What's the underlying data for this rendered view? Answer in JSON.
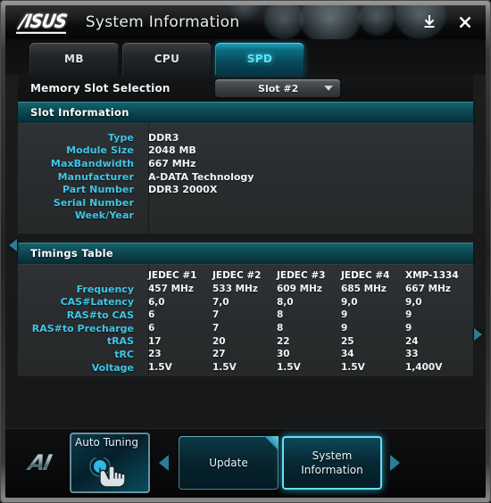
{
  "window": {
    "brand": "/ISUS",
    "title": "System Information",
    "buttons": [
      {
        "name": "save-icon",
        "label": "download"
      },
      {
        "name": "close-icon",
        "label": "close"
      }
    ]
  },
  "tabs": [
    {
      "id": "mb",
      "label": "MB",
      "active": false
    },
    {
      "id": "cpu",
      "label": "CPU",
      "active": false
    },
    {
      "id": "spd",
      "label": "SPD",
      "active": true
    }
  ],
  "slot_selection": {
    "label": "Memory Slot Selection",
    "value": "Slot #2",
    "caret": "chevron-down-icon"
  },
  "slot_information": {
    "heading": "Slot Information",
    "rows": [
      {
        "key": "Type",
        "value": "DDR3"
      },
      {
        "key": "Module Size",
        "value": "2048 MB"
      },
      {
        "key": "MaxBandwidth",
        "value": "667 MHz"
      },
      {
        "key": "Manufacturer",
        "value": "A-DATA Technology"
      },
      {
        "key": "Part Number",
        "value": "DDR3 2000X"
      },
      {
        "key": "Serial Number",
        "value": ""
      },
      {
        "key": "Week/Year",
        "value": ""
      }
    ]
  },
  "timings_table": {
    "heading": "Timings Table",
    "columns": [
      "JEDEC #1",
      "JEDEC #2",
      "JEDEC #3",
      "JEDEC #4",
      "XMP-1334"
    ],
    "rows": [
      {
        "key": "Frequency",
        "values": [
          "457 MHz",
          "533 MHz",
          "609 MHz",
          "685 MHz",
          "667 MHz"
        ]
      },
      {
        "key": "CAS#Latency",
        "values": [
          "6,0",
          "7,0",
          "8,0",
          "9,0",
          "9,0"
        ]
      },
      {
        "key": "RAS#to CAS",
        "values": [
          "6",
          "7",
          "8",
          "9",
          "9"
        ]
      },
      {
        "key": "RAS#to Precharge",
        "values": [
          "6",
          "7",
          "8",
          "9",
          "9"
        ]
      },
      {
        "key": "tRAS",
        "values": [
          "17",
          "20",
          "22",
          "25",
          "24"
        ]
      },
      {
        "key": "tRC",
        "values": [
          "23",
          "27",
          "30",
          "34",
          "33"
        ]
      },
      {
        "key": "Voltage",
        "values": [
          "1.5V",
          "1.5V",
          "1.5V",
          "1.5V",
          "1,400V"
        ]
      }
    ]
  },
  "side_nav": {
    "left": "scroll-left-arrow",
    "right": "scroll-right-arrow"
  },
  "dock": {
    "logo": "AI",
    "tile": {
      "label": "Auto Tuning",
      "icon": "hand-touch-icon"
    },
    "prev_arrow": "dock-prev-arrow",
    "next_arrow": "dock-next-arrow",
    "buttons": [
      {
        "id": "update",
        "label": "Update",
        "active": false
      },
      {
        "id": "system-information",
        "label": "System\nInformation",
        "active": true
      }
    ]
  },
  "colors": {
    "accent": "#3fc6e8",
    "active_tab": "#55e6ff",
    "section_header": "#0f4e59",
    "panel": "#2a2d2f",
    "text": "#f2f5f7"
  }
}
